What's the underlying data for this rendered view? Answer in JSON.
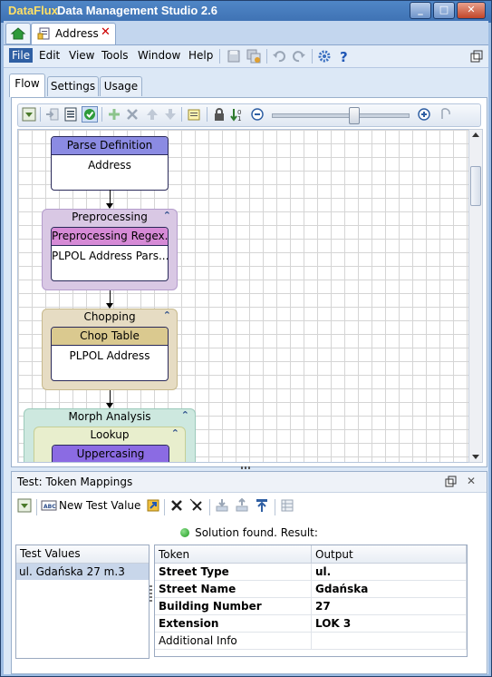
{
  "window": {
    "brand": "DataFlux",
    "title": "Data Management Studio 2.6",
    "min": "_",
    "max": "□",
    "close": "✕"
  },
  "doc_tab": {
    "label": "Address",
    "close": "✕"
  },
  "menu": [
    "File",
    "Edit",
    "View",
    "Tools",
    "Window",
    "Help"
  ],
  "tabs": [
    "Flow",
    "Settings",
    "Usage"
  ],
  "flow": {
    "parse": {
      "header": "Parse Definition",
      "body": "Address"
    },
    "preprocessing": {
      "title": "Preprocessing",
      "node_header": "Preprocessing Regex...",
      "node_body": "PLPOL Address Pars..."
    },
    "chopping": {
      "title": "Chopping",
      "node_header": "Chop Table",
      "node_body": "PLPOL Address"
    },
    "morph": {
      "title": "Morph Analysis",
      "lookup": "Lookup",
      "node_header": "Uppercasing"
    },
    "chevron": "⌃"
  },
  "bottom": {
    "title": "Test: Token Mappings",
    "new_test_value": "New Test Value",
    "status": "Solution found. Result:",
    "test_values_header": "Test Values",
    "test_values": [
      "ul. Gdańska 27 m.3"
    ],
    "token_header": "Token",
    "output_header": "Output",
    "rows": [
      {
        "token": "Street Type",
        "output": "ul."
      },
      {
        "token": "Street Name",
        "output": "Gdańska"
      },
      {
        "token": "Building Number",
        "output": "27"
      },
      {
        "token": "Extension",
        "output": "LOK 3"
      },
      {
        "token": "Additional Info",
        "output": ""
      }
    ]
  }
}
